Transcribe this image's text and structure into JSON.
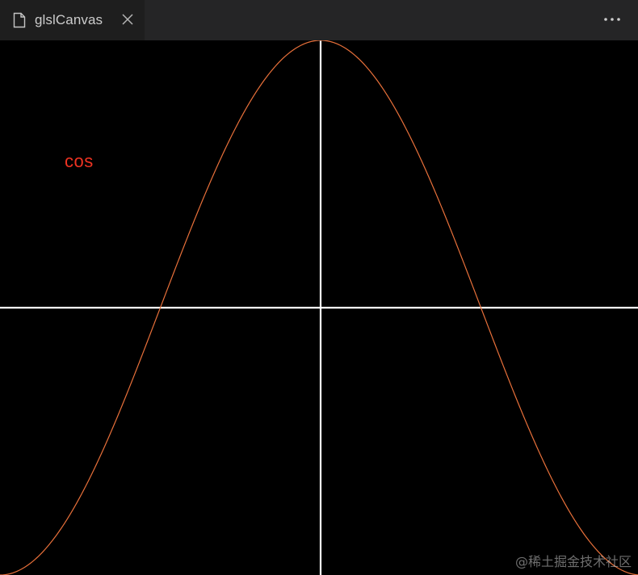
{
  "tab": {
    "title": "glslCanvas",
    "file_icon": "file-icon",
    "close_icon": "close-icon"
  },
  "toolbar": {
    "more_icon": "more-actions-icon"
  },
  "canvas": {
    "label": "cos",
    "watermark": "@稀土掘金技术社区"
  },
  "colors": {
    "tabbar_bg": "#252526",
    "tab_active_bg": "#1e1e1e",
    "canvas_bg": "#000000",
    "axis": "#ffffff",
    "curve": "#e8703a",
    "label": "#ee3322"
  },
  "chart_data": {
    "type": "line",
    "function": "cos",
    "x": [
      -3.1416,
      -2.3562,
      -1.5708,
      -0.7854,
      0,
      0.7854,
      1.5708,
      2.3562,
      3.1416
    ],
    "y": [
      -1,
      -0.7071,
      0,
      0.7071,
      1,
      0.7071,
      0,
      -0.7071,
      -1
    ],
    "xlim": [
      -3.1416,
      3.1416
    ],
    "ylim": [
      -1,
      1
    ],
    "grid": false,
    "legend": "none"
  }
}
